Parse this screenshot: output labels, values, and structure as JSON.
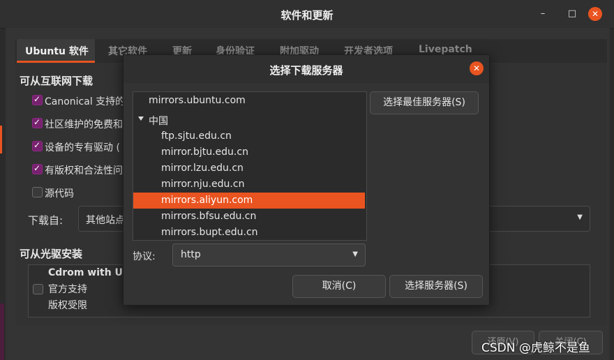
{
  "window": {
    "title": "软件和更新",
    "minimize": "–",
    "maximize": "□",
    "close": "✕"
  },
  "tabs": [
    {
      "label": "Ubuntu 软件",
      "active": true
    },
    {
      "label": "其它软件"
    },
    {
      "label": "更新"
    },
    {
      "label": "身份验证"
    },
    {
      "label": "附加驱动"
    },
    {
      "label": "开发者选项"
    },
    {
      "label": "Livepatch"
    }
  ],
  "internet": {
    "heading": "可从互联网下载",
    "options": [
      {
        "label": "Canonical 支持的",
        "checked": true
      },
      {
        "label": "社区维护的免费和",
        "checked": true
      },
      {
        "label": "设备的专有驱动 (",
        "checked": true
      },
      {
        "label": "有版权和合法性问",
        "checked": true
      },
      {
        "label": "源代码",
        "checked": false
      }
    ],
    "download_from_label": "下载自:",
    "download_from_value": "其他站点"
  },
  "cdrom": {
    "heading": "可从光驱安装",
    "name": "Cdrom with Ub",
    "line1": "官方支持",
    "line2": "版权受限",
    "checked": false
  },
  "bottom_buttons": [
    "还原(V)",
    "关闭(C)"
  ],
  "dialog": {
    "title": "选择下载服务器",
    "close": "✕",
    "servers": [
      {
        "label": "mirrors.ubuntu.com",
        "level": 0
      },
      {
        "label": "中国",
        "level": 0,
        "expanded": true
      },
      {
        "label": "ftp.sjtu.edu.cn",
        "level": 1
      },
      {
        "label": "mirror.bjtu.edu.cn",
        "level": 1
      },
      {
        "label": "mirror.lzu.edu.cn",
        "level": 1
      },
      {
        "label": "mirror.nju.edu.cn",
        "level": 1
      },
      {
        "label": "mirrors.aliyun.com",
        "level": 1,
        "selected": true
      },
      {
        "label": "mirrors.bfsu.edu.cn",
        "level": 1
      },
      {
        "label": "mirrors.bupt.edu.cn",
        "level": 1
      }
    ],
    "best_server_button": "选择最佳服务器(S)",
    "protocol_label": "协议:",
    "protocol_value": "http",
    "cancel_button": "取消(C)",
    "choose_button": "选择服务器(S)"
  },
  "watermark": "CSDN @虎鲸不是鱼",
  "colors": {
    "accent": "#e95420",
    "checkbox": "#77216f"
  }
}
